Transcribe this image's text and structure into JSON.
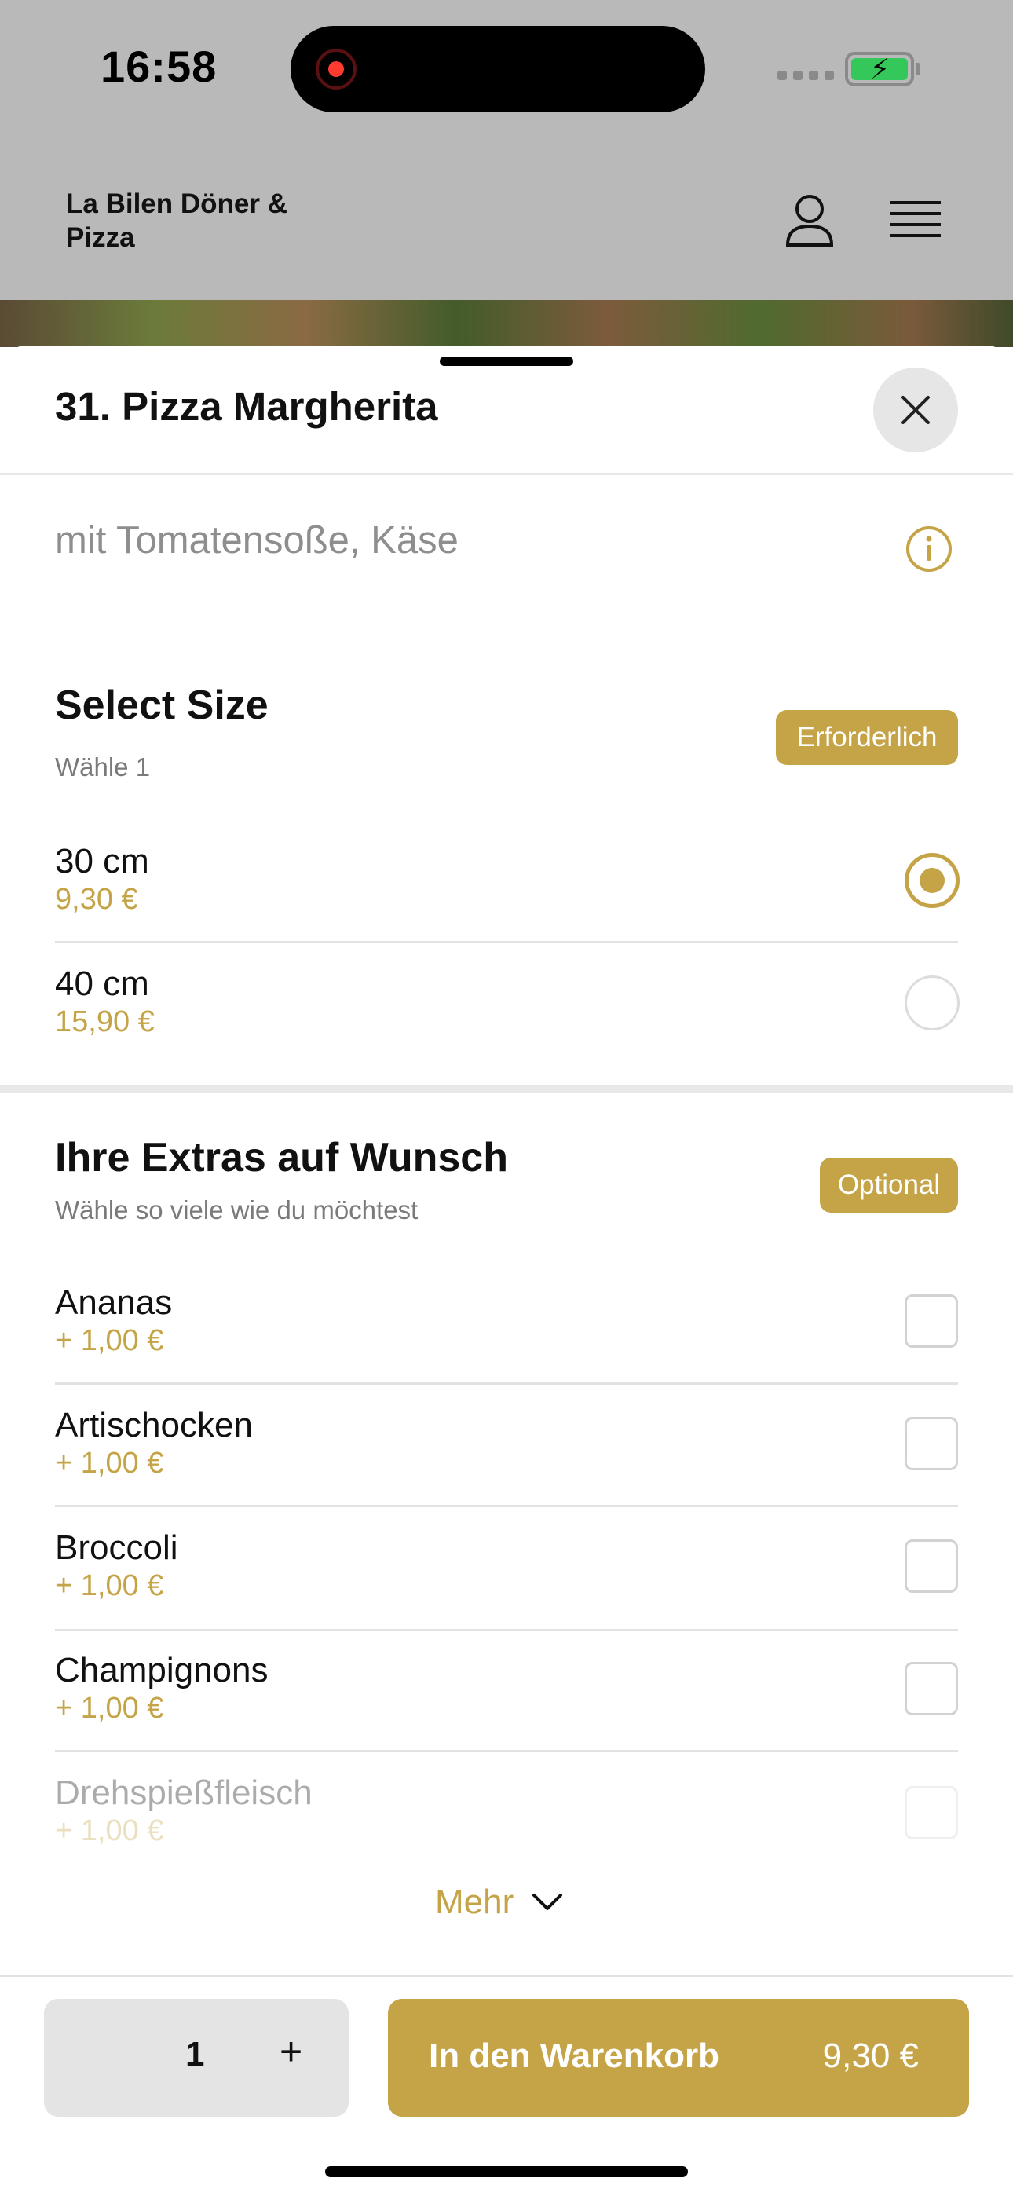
{
  "status_bar": {
    "time": "16:58"
  },
  "header": {
    "restaurant_name": "La Bilen Döner & Pizza"
  },
  "sheet": {
    "title": "31. Pizza Margherita",
    "description": "mit Tomatensoße, Käse"
  },
  "size_section": {
    "title": "Select Size",
    "subtitle": "Wähle 1",
    "badge": "Erforderlich",
    "options": [
      {
        "name": "30 cm",
        "price": "9,30 €",
        "selected": true
      },
      {
        "name": "40 cm",
        "price": "15,90 €",
        "selected": false
      }
    ]
  },
  "extras_section": {
    "title": "Ihre Extras auf Wunsch",
    "subtitle": "Wähle so viele wie du möchtest",
    "badge": "Optional",
    "items": [
      {
        "name": "Ananas",
        "price": "+ 1,00 €"
      },
      {
        "name": "Artischocken",
        "price": "+ 1,00 €"
      },
      {
        "name": "Broccoli",
        "price": "+ 1,00 €"
      },
      {
        "name": "Champignons",
        "price": "+ 1,00 €"
      },
      {
        "name": "Drehspießfleisch",
        "price": "+ 1,00 €"
      }
    ],
    "more_label": "Mehr"
  },
  "footer": {
    "quantity": "1",
    "plus": "+",
    "add_to_cart_label": "In den Warenkorb",
    "total_price": "9,30 €"
  },
  "colors": {
    "accent": "#c4a447",
    "overlay": "#b9b9b9",
    "qty_bg": "#e4e4e4"
  }
}
